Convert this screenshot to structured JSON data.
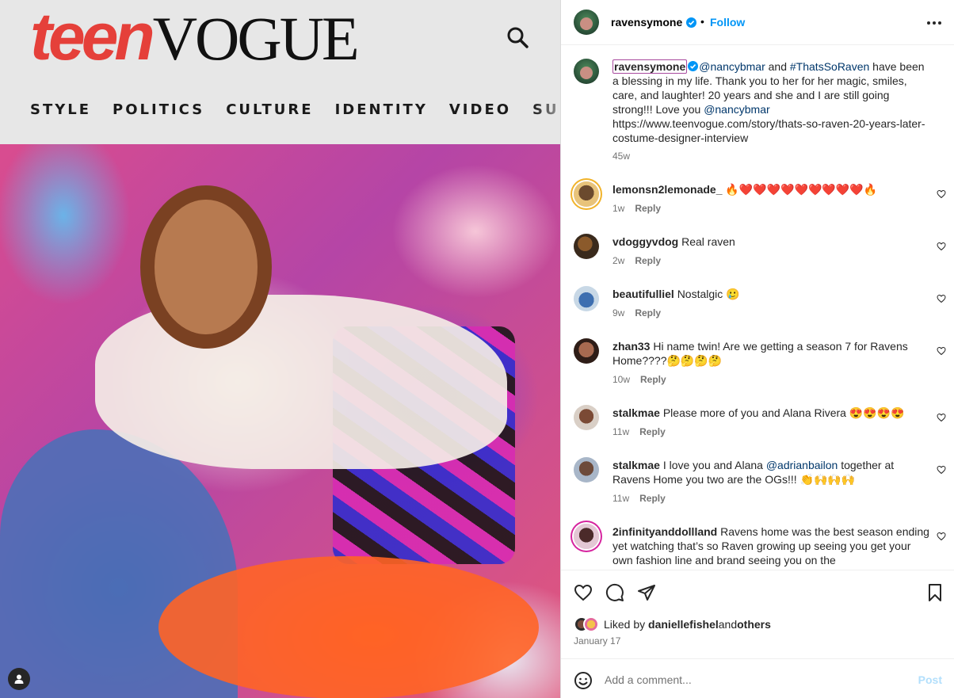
{
  "media": {
    "teen_vogue_header": {
      "logo_teen": "teen",
      "logo_vogue": "VOGUE",
      "nav": [
        "STYLE",
        "POLITICS",
        "CULTURE",
        "IDENTITY",
        "VIDEO",
        "SUMMI"
      ]
    }
  },
  "post_header": {
    "username": "ravensymone",
    "separator": "•",
    "follow_label": "Follow"
  },
  "caption": {
    "username": "ravensymone",
    "mention1": "@nancybmar",
    "and": " and ",
    "hashtag": "#ThatsSoRaven",
    "text1": " have been a blessing in my life. Thank you to her for her magic, smiles, care, and laughter! 20 years and she and I are still going strong!!! Love you ",
    "mention2": "@nancybmar",
    "url": "https://www.teenvogue.com/story/thats-so-raven-20-years-later-costume-designer-interview",
    "time": "45w"
  },
  "comments": [
    {
      "username": "lemonsn2lemonade_",
      "text": "🔥❤️❤️❤️❤️❤️❤️❤️❤️❤️🔥",
      "time": "1w",
      "reply": "Reply"
    },
    {
      "username": "vdoggyvdog",
      "text": "Real raven",
      "time": "2w",
      "reply": "Reply"
    },
    {
      "username": "beautifulliel",
      "text": "Nostalgic 🥲",
      "time": "9w",
      "reply": "Reply"
    },
    {
      "username": "zhan33",
      "text": "Hi name twin! Are we getting a season 7 for Ravens Home????🤔🤔🤔🤔",
      "time": "10w",
      "reply": "Reply"
    },
    {
      "username": "stalkmae",
      "text": "Please more of you and Alana Rivera 😍😍😍😍",
      "time": "11w",
      "reply": "Reply"
    },
    {
      "username": "stalkmae",
      "text_pre": "I love you and Alana ",
      "mention": "@adrianbailon",
      "text_post": " together at Ravens Home you two are the OGs!!! 👏🙌🙌🙌",
      "time": "11w",
      "reply": "Reply"
    },
    {
      "username": "2infinityanddollland",
      "text": "Ravens home was the best season ending yet watching that’s so Raven growing up seeing you get your own fashion line and brand seeing you on the"
    }
  ],
  "likes": {
    "prefix": "Liked by ",
    "user": "daniellefishel",
    "and": " and ",
    "others": "others",
    "date": "January 17"
  },
  "add_comment": {
    "placeholder": "Add a comment...",
    "post_label": "Post"
  },
  "icons": {
    "search": "search-icon",
    "verified": "verified-badge-icon",
    "more": "more-options-icon",
    "like": "heart-icon",
    "comment": "comment-icon",
    "share": "share-icon",
    "save": "bookmark-icon",
    "emoji": "emoji-icon",
    "user_tag": "user-tag-icon"
  },
  "colors": {
    "accent": "#0095f6",
    "link": "#00376b",
    "teen_red": "#e5403a",
    "post_disabled": "#b2dffc"
  }
}
